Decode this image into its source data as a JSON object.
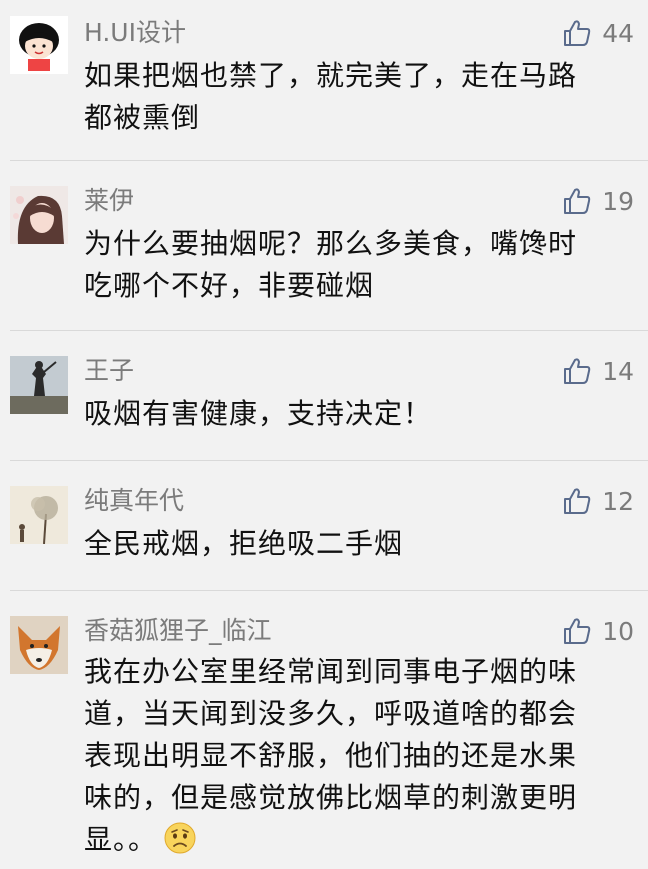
{
  "comments": [
    {
      "username": "H.UI设计",
      "likes": "44",
      "lines": [
        "如果把烟也禁了，就完美了，走在马路",
        "都被熏倒"
      ]
    },
    {
      "username": "莱伊",
      "likes": "19",
      "lines": [
        "为什么要抽烟呢？那么多美食，嘴馋时",
        "吃哪个不好，非要碰烟"
      ]
    },
    {
      "username": "王子",
      "likes": "14",
      "lines": [
        "吸烟有害健康，支持决定！"
      ]
    },
    {
      "username": "纯真年代",
      "likes": "12",
      "lines": [
        "全民戒烟，拒绝吸二手烟"
      ]
    },
    {
      "username": "香菇狐狸子_临江",
      "likes": "10",
      "lines": [
        "我在办公室里经常闻到同事电子烟的味",
        "道，当天闻到没多久，呼吸道啥的都会",
        "表现出明显不舒服，他们抽的还是水果",
        "味的，但是感觉放佛比烟草的刺激更明",
        "显。。"
      ]
    }
  ],
  "colors": {
    "background": "#f2f2f2",
    "username": "#7b7b7b",
    "text": "#111111",
    "like_icon": "#5a6b8c"
  },
  "icons": {
    "like": "thumbs-up-icon",
    "emoji": "worried-face-emoji"
  }
}
